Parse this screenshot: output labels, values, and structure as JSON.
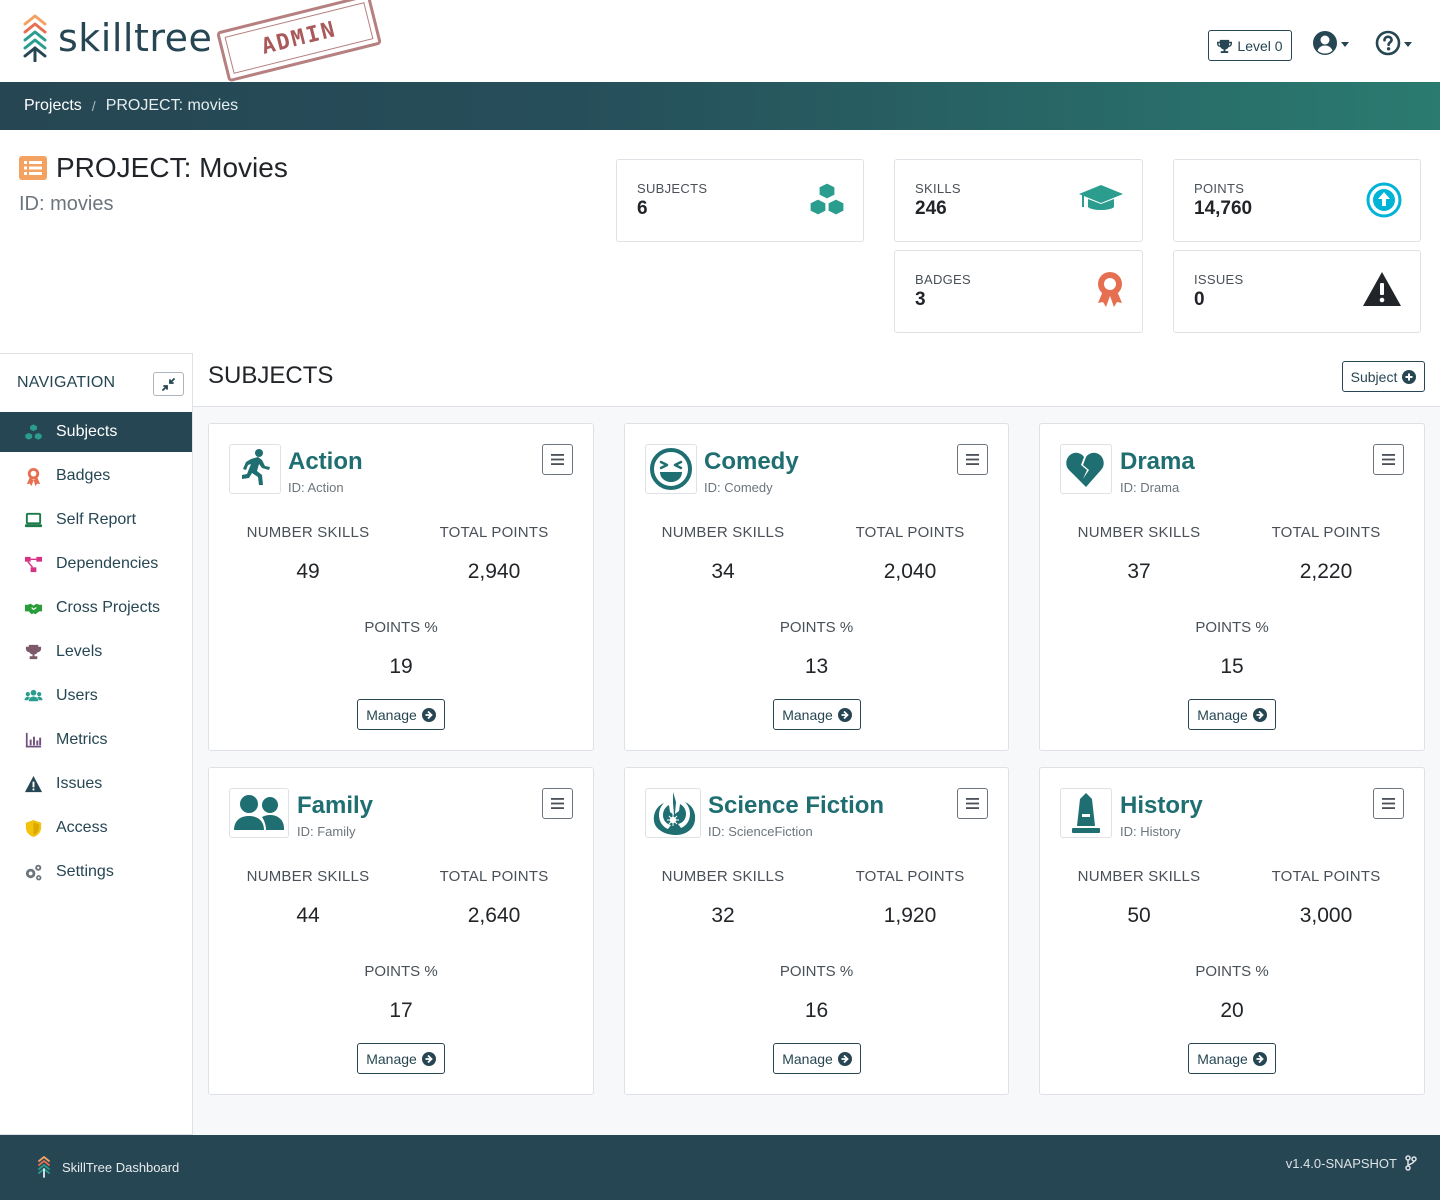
{
  "app": {
    "logo_text": "skilltree",
    "admin_stamp": "ADMIN"
  },
  "header": {
    "level_label": "Level 0",
    "user_icon": "user-circle-icon",
    "help_icon": "help-circle-icon"
  },
  "breadcrumb": {
    "root": "Projects",
    "current": "PROJECT: movies"
  },
  "project": {
    "title": "PROJECT: Movies",
    "id_label": "ID: movies"
  },
  "stats": {
    "subjects": {
      "label": "SUBJECTS",
      "value": "6",
      "icon": "cubes-icon",
      "color": "#2a9d8f"
    },
    "skills": {
      "label": "SKILLS",
      "value": "246",
      "icon": "graduation-cap-icon",
      "color": "#2a9d8f"
    },
    "points": {
      "label": "POINTS",
      "value": "14,760",
      "icon": "arrow-circle-up-icon",
      "color": "#00b4d8"
    },
    "badges": {
      "label": "BADGES",
      "value": "3",
      "icon": "award-icon",
      "color": "#e76f51"
    },
    "issues": {
      "label": "ISSUES",
      "value": "0",
      "icon": "warning-icon",
      "color": "#212529"
    }
  },
  "nav": {
    "heading": "NAVIGATION",
    "items": [
      {
        "label": "Subjects",
        "icon": "cubes-icon",
        "active": true
      },
      {
        "label": "Badges",
        "icon": "award-icon"
      },
      {
        "label": "Self Report",
        "icon": "laptop-icon"
      },
      {
        "label": "Dependencies",
        "icon": "project-diagram-icon"
      },
      {
        "label": "Cross Projects",
        "icon": "handshake-icon"
      },
      {
        "label": "Levels",
        "icon": "trophy-icon"
      },
      {
        "label": "Users",
        "icon": "users-icon"
      },
      {
        "label": "Metrics",
        "icon": "chart-bar-icon"
      },
      {
        "label": "Issues",
        "icon": "warning-icon"
      },
      {
        "label": "Access",
        "icon": "shield-icon"
      },
      {
        "label": "Settings",
        "icon": "cogs-icon"
      }
    ]
  },
  "subjects_section": {
    "title": "SUBJECTS",
    "add_button": "Subject",
    "labels": {
      "skills": "NUMBER SKILLS",
      "points": "TOTAL POINTS",
      "pct": "POINTS %",
      "manage": "Manage"
    },
    "cards": [
      {
        "name": "Action",
        "id": "ID: Action",
        "icon": "running-icon",
        "skills": "49",
        "points": "2,940",
        "pct": "19"
      },
      {
        "name": "Comedy",
        "id": "ID: Comedy",
        "icon": "laugh-squint-icon",
        "skills": "34",
        "points": "2,040",
        "pct": "13"
      },
      {
        "name": "Drama",
        "id": "ID: Drama",
        "icon": "heart-broken-icon",
        "skills": "37",
        "points": "2,220",
        "pct": "15"
      },
      {
        "name": "Family",
        "id": "ID: Family",
        "icon": "user-friends-icon",
        "skills": "44",
        "points": "2,640",
        "pct": "17"
      },
      {
        "name": "Science Fiction",
        "id": "ID: ScienceFiction",
        "icon": "jedi-order-icon",
        "skills": "32",
        "points": "1,920",
        "pct": "16"
      },
      {
        "name": "History",
        "id": "ID: History",
        "icon": "monument-icon",
        "skills": "50",
        "points": "3,000",
        "pct": "20"
      }
    ]
  },
  "footer": {
    "brand": "SkillTree Dashboard",
    "version": "v1.4.0-SNAPSHOT"
  },
  "colors": {
    "primary": "#264653",
    "teal": "#1f6e71",
    "orange": "#f4a261"
  }
}
